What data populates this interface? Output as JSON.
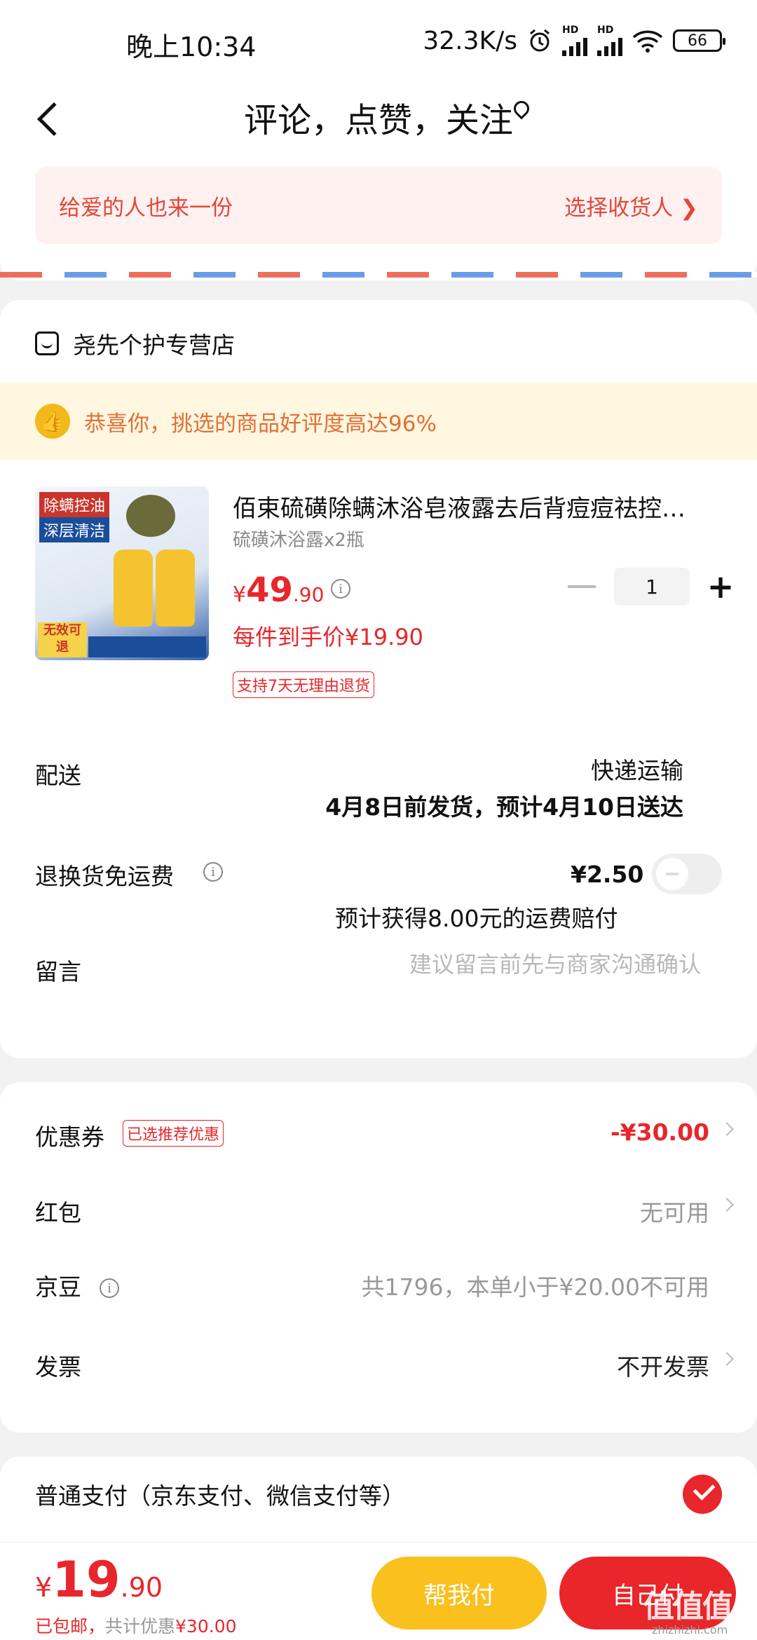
{
  "status": {
    "time": "晚上10:34",
    "speed": "32.3K/s",
    "hd1": "HD",
    "hd2": "HD",
    "battery": "66",
    "icons": [
      "alarm-icon",
      "signal-icon",
      "signal-icon",
      "wifi-icon",
      "battery-icon"
    ]
  },
  "header": {
    "title": "评论，点赞，关注"
  },
  "gift": {
    "left": "给爱的人也来一份",
    "right": "选择收货人 ❯"
  },
  "store": {
    "name": "尧先个护专营店",
    "praise": "恭喜你，挑选的商品好评度高达96%"
  },
  "product": {
    "image_text": {
      "line1": "除螨控油",
      "line2": "深层清洁",
      "badge": "无效可退"
    },
    "title": "佰束硫磺除螨沐浴皂液露去后背痘痘祛控…",
    "spec": "硫磺沐浴露x2瓶",
    "price_symbol": "¥",
    "price_int": "49",
    "price_dec": ".90",
    "quantity": "1",
    "unit_price": "每件到手价¥19.90",
    "return_tag": "支持7天无理由退货"
  },
  "shipping": {
    "label": "配送",
    "method": "快递运输",
    "eta": "4月8日前发货，预计4月10日送达"
  },
  "return_fee": {
    "label": "退换货免运费",
    "amount": "¥2.50",
    "note": "预计获得8.00元的运费赔付",
    "enabled": false
  },
  "message": {
    "label": "留言",
    "placeholder": "建议留言前先与商家沟通确认"
  },
  "discounts": {
    "coupon_label": "优惠券",
    "coupon_tag": "已选推荐优惠",
    "coupon_value": "-¥30.00",
    "redpacket_label": "红包",
    "redpacket_value": "无可用",
    "jd_label": "京豆",
    "jd_value": "共1796，本单小于¥20.00不可用",
    "invoice_label": "发票",
    "invoice_value": "不开发票"
  },
  "payment": {
    "label": "普通支付（京东支付、微信支付等）",
    "selected": true
  },
  "bottom": {
    "total_symbol": "¥",
    "total_int": "19",
    "total_dec": ".90",
    "note_free": "已包邮，",
    "note_saved": "共计优惠",
    "note_amount": "¥30.00",
    "help_pay": "帮我付",
    "self_pay": "自己付",
    "watermark": "值值值",
    "watermark_url": "zhizhizhi.com"
  },
  "colors": {
    "accent_red": "#e8262b",
    "accent_yellow": "#f9c01e",
    "praise_bg": "#fff7e0"
  }
}
